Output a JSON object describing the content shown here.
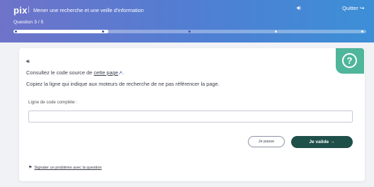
{
  "header": {
    "logo": "pix",
    "assessment_title": "Mener une recherche et une veille d'information",
    "sound_icon": "speaker-icon",
    "quit_label": "Quitter",
    "quit_icon": "↪",
    "question_counter": "Question 3 / 5",
    "progress": {
      "current": 3,
      "total": 5
    }
  },
  "question": {
    "badge_icon": "?",
    "sound_icon": "speaker-icon",
    "instruction_prefix": "Consultez le code source de ",
    "instruction_link": "cette page",
    "link_icon": "↗",
    "instruction_suffix": ".",
    "instruction_2": "Copiez la ligne qui indique aux moteurs de recherche de ne pas référencer la page.",
    "field_label": "Ligne de code complète :",
    "field_value": ""
  },
  "actions": {
    "skip_label": "Je passe",
    "validate_label": "Je valide  →"
  },
  "report": {
    "label": "Signaler un problème avec la question"
  },
  "colors": {
    "accent_green": "#4fb69b",
    "validate_button": "#1f4f49",
    "header_gradient_start": "#6e73c9",
    "header_gradient_end": "#3c8fd6"
  }
}
